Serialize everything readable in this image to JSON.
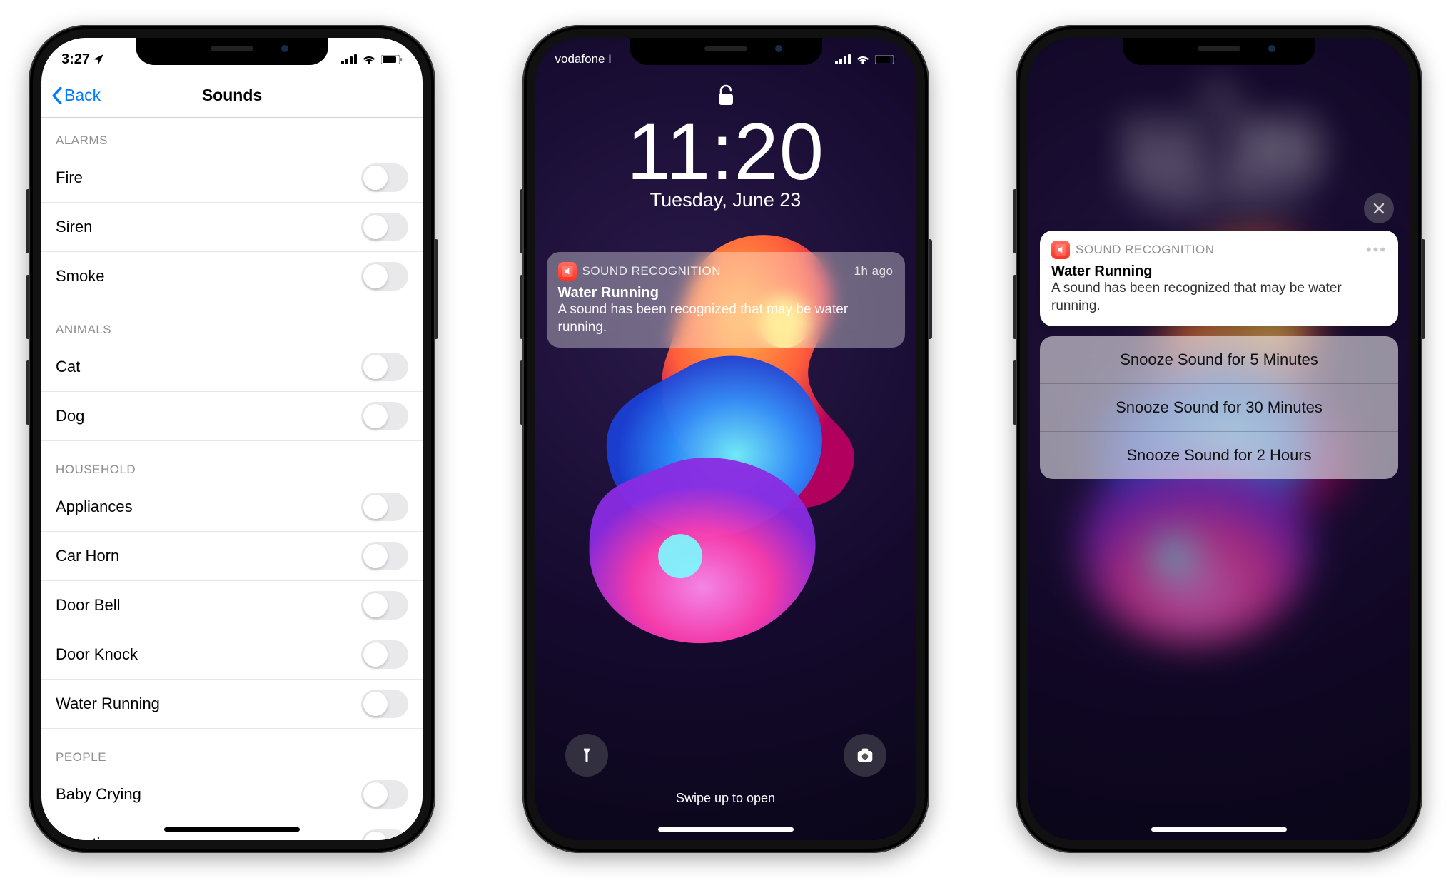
{
  "phone1": {
    "status": {
      "time": "3:27"
    },
    "nav": {
      "back": "Back",
      "title": "Sounds"
    },
    "sections": [
      {
        "header": "ALARMS",
        "items": [
          "Fire",
          "Siren",
          "Smoke"
        ]
      },
      {
        "header": "ANIMALS",
        "items": [
          "Cat",
          "Dog"
        ]
      },
      {
        "header": "HOUSEHOLD",
        "items": [
          "Appliances",
          "Car Horn",
          "Door Bell",
          "Door Knock",
          "Water Running"
        ]
      },
      {
        "header": "PEOPLE",
        "items": [
          "Baby Crying",
          "Shouting"
        ]
      }
    ]
  },
  "phone2": {
    "status": {
      "carrier": "vodafone I"
    },
    "lock": {
      "time": "11:20",
      "date": "Tuesday, June 23"
    },
    "notification": {
      "source": "SOUND RECOGNITION",
      "time": "1h ago",
      "title": "Water Running",
      "body": "A sound has been recognized that may be water running."
    },
    "swipe": "Swipe up to open"
  },
  "phone3": {
    "notification": {
      "source": "SOUND RECOGNITION",
      "title": "Water Running",
      "body": "A sound has been recognized that may be water running."
    },
    "snooze": [
      "Snooze Sound for 5 Minutes",
      "Snooze Sound for 30 Minutes",
      "Snooze Sound for 2 Hours"
    ]
  }
}
